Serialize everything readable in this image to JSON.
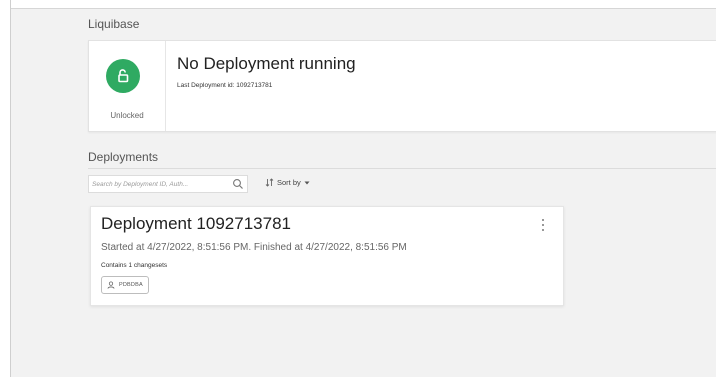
{
  "liquibase": {
    "section_title": "Liquibase",
    "lock_status": "Unlocked",
    "status_title": "No Deployment running",
    "last_deployment": "Last Deployment id: 1092713781",
    "icon": "unlock-icon",
    "accent": "#2faa62"
  },
  "deployments": {
    "section_title": "Deployments",
    "search": {
      "placeholder": "Search by Deployment ID, Auth...",
      "value": ""
    },
    "sort_label": "Sort by",
    "cards": [
      {
        "title": "Deployment 1092713781",
        "timing": "Started at 4/27/2022, 8:51:56 PM. Finished at 4/27/2022, 8:51:56 PM",
        "changeset_count": "Contains 1 changesets",
        "author": "PDBDBA"
      }
    ]
  }
}
